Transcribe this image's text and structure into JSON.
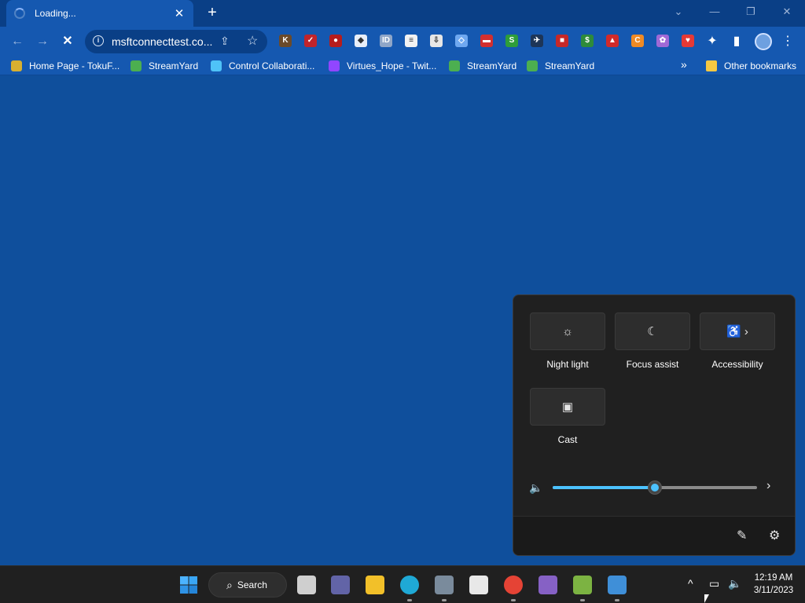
{
  "browser": {
    "tab": {
      "title": "Loading...",
      "close": "✕"
    },
    "new_tab": "+",
    "window_controls": {
      "menu": "⌄",
      "minimize": "—",
      "restore": "❐",
      "close": "✕"
    },
    "nav": {
      "back": "←",
      "forward": "→",
      "stop": "✕"
    },
    "omnibox": {
      "url": "msftconnecttest.co...",
      "info": "i",
      "share": "⇪",
      "star": "☆"
    },
    "extensions": [
      {
        "icon": "k-extension-icon",
        "letter": "K",
        "color": "#6b4a2a"
      },
      {
        "icon": "red-check-extension-icon",
        "letter": "✓",
        "color": "#c0242b"
      },
      {
        "icon": "red-logo-extension-icon",
        "letter": "●",
        "color": "#b71c1c"
      },
      {
        "icon": "white-square-extension-icon",
        "letter": "◆",
        "color": "#e8eef8"
      },
      {
        "icon": "id-extension-icon",
        "letter": "ID",
        "color": "#8fa6c8"
      },
      {
        "icon": "ciel-extension-icon",
        "letter": "≡",
        "color": "#f2f2f2"
      },
      {
        "icon": "download-extension-icon",
        "letter": "⇩",
        "color": "#e6e6e6"
      },
      {
        "icon": "roblox-extension-icon",
        "letter": "◇",
        "color": "#6fa8f0"
      },
      {
        "icon": "red-pill-extension-icon",
        "letter": "▬",
        "color": "#d32f2f"
      },
      {
        "icon": "green-circle-extension-icon",
        "letter": "S",
        "color": "#2e9d3a"
      },
      {
        "icon": "dark-bird-extension-icon",
        "letter": "✈",
        "color": "#1d3557"
      },
      {
        "icon": "red-extension-icon",
        "letter": "■",
        "color": "#c62828"
      },
      {
        "icon": "green-dollar-extension-icon",
        "letter": "$",
        "color": "#2e8b3a"
      },
      {
        "icon": "red-chat-extension-icon",
        "letter": "▲",
        "color": "#d12a2a"
      },
      {
        "icon": "orange-badge-extension-icon",
        "letter": "C",
        "color": "#f08a24"
      },
      {
        "icon": "colorful-extension-icon",
        "letter": "✿",
        "color": "#a069d6"
      },
      {
        "icon": "red-heart-extension-icon",
        "letter": "♥",
        "color": "#e53935"
      }
    ],
    "puzzle_icon": "✦",
    "sidepanel_icon": "▮",
    "menu_icon": "⋮",
    "bookmarks": [
      {
        "label": "Home Page - TokuF...",
        "color": "#d8b030"
      },
      {
        "label": "StreamYard",
        "color": "#4caf50"
      },
      {
        "label": "Control Collaborati...",
        "color": "#4fc3f7"
      },
      {
        "label": "Virtues_Hope - Twit...",
        "color": "#9146ff"
      },
      {
        "label": "StreamYard",
        "color": "#4caf50"
      },
      {
        "label": "StreamYard",
        "color": "#4caf50"
      }
    ],
    "bookmarks_overflow": "»",
    "other_bookmarks": {
      "label": "Other bookmarks",
      "color": "#f5c842"
    }
  },
  "quick_settings": {
    "tiles": [
      {
        "name": "night-light",
        "label": "Night light",
        "glyph": "☼",
        "icon": "night-light-icon"
      },
      {
        "name": "focus-assist",
        "label": "Focus assist",
        "glyph": "☾",
        "icon": "moon-icon"
      },
      {
        "name": "accessibility",
        "label": "Accessibility",
        "glyph": "♿ ›",
        "icon": "accessibility-icon"
      },
      {
        "name": "cast",
        "label": "Cast",
        "glyph": "▣",
        "icon": "cast-icon"
      }
    ],
    "volume": {
      "icon": "🔈",
      "level": 0.5,
      "more": "›"
    },
    "footer": {
      "edit": "✎",
      "settings": "⚙"
    }
  },
  "taskbar": {
    "search_label": "Search",
    "search_icon": "⌕",
    "apps": [
      {
        "name": "start",
        "color": "#2b95e9",
        "running": false
      },
      {
        "name": "task-view",
        "color": "#cfcfcf",
        "running": false
      },
      {
        "name": "teams-chat",
        "color": "#6264a7",
        "running": false
      },
      {
        "name": "file-explorer",
        "color": "#f2c029",
        "running": false
      },
      {
        "name": "edge",
        "color": "#1fa9d6",
        "running": true
      },
      {
        "name": "settings",
        "color": "#7a8b9c",
        "running": true
      },
      {
        "name": "microsoft-store",
        "color": "#e8e8e8",
        "running": false
      },
      {
        "name": "chrome",
        "color": "#e54335",
        "running": true
      },
      {
        "name": "visual-studio",
        "color": "#8661c5",
        "running": false
      },
      {
        "name": "game",
        "color": "#7cb342",
        "running": true
      },
      {
        "name": "photos",
        "color": "#3f8fd8",
        "running": true
      }
    ],
    "tray": {
      "chevron": "^",
      "network": "▭",
      "volume": "🔈"
    },
    "clock": {
      "time": "12:19 AM",
      "date": "3/11/2023"
    }
  }
}
